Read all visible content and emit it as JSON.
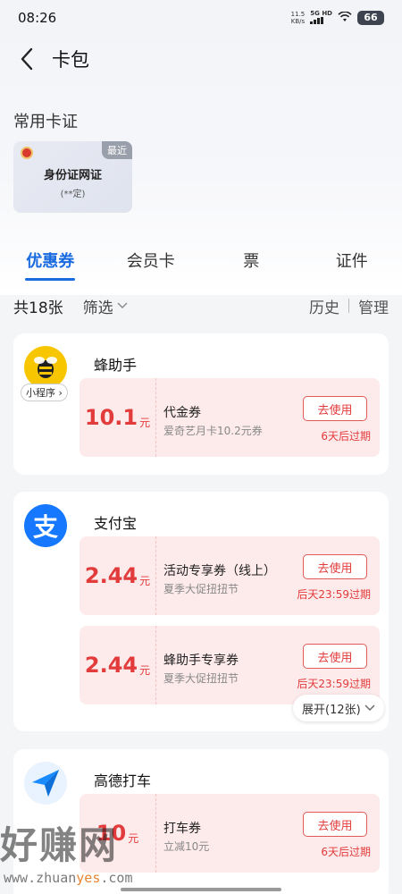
{
  "status_bar": {
    "time": "08:26",
    "speed_value": "11.5",
    "speed_unit": "KB/s",
    "network": "5G HD",
    "battery": "66"
  },
  "header": {
    "title": "卡包"
  },
  "common_cards": {
    "title": "常用卡证",
    "card": {
      "badge": "最近",
      "name": "身份证网证",
      "subtitle": "(**定)"
    }
  },
  "tabs": [
    "优惠券",
    "会员卡",
    "票",
    "证件"
  ],
  "active_tab": 0,
  "filter_bar": {
    "total": "共18张",
    "filter_label": "筛选",
    "history": "历史",
    "manage": "管理"
  },
  "merchants": [
    {
      "name": "蜂助手",
      "tag": "小程序",
      "coupons": [
        {
          "amount": "10.1",
          "unit": "元",
          "name": "代金券",
          "desc": "爱奇艺月卡10.2元券",
          "button": "去使用",
          "expire": "6天后过期"
        }
      ]
    },
    {
      "name": "支付宝",
      "coupons": [
        {
          "amount": "2.44",
          "unit": "元",
          "name": "活动专享券（线上）",
          "desc": "夏季大促扭扭节",
          "button": "去使用",
          "expire": "后天23:59过期"
        },
        {
          "amount": "2.44",
          "unit": "元",
          "name": "蜂助手专享券",
          "desc": "夏季大促扭扭节",
          "button": "去使用",
          "expire": "后天23:59过期"
        }
      ],
      "expand_label": "展开(12张)"
    },
    {
      "name": "高德打车",
      "coupons": [
        {
          "amount": "10",
          "unit": "元",
          "name": "打车券",
          "desc": "立减10元",
          "button": "去使用",
          "expire": "6天后过期"
        }
      ]
    }
  ],
  "watermark": {
    "text": "好赚网",
    "url_prefix": "www.zhuan",
    "url_highlight": "yes",
    "url_suffix": ".com"
  },
  "colors": {
    "accent": "#1a6be0",
    "coupon_red": "#e23b3b",
    "coupon_bg": "#fdeaeb"
  }
}
